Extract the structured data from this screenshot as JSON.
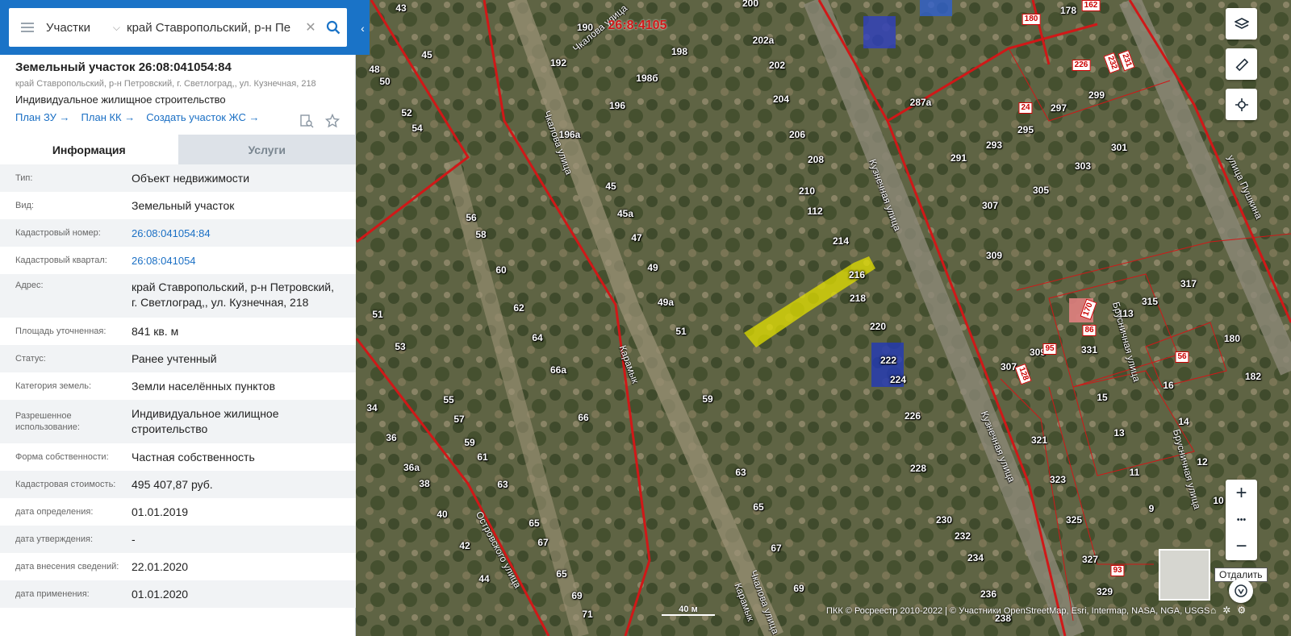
{
  "search": {
    "type_label": "Участки",
    "value": "край Ставропольский, р-н Пе",
    "clear": "✕"
  },
  "object": {
    "title": "Земельный участок 26:08:041054:84",
    "address": "край Ставропольский, р-н Петровский, г. Светлоград,, ул. Кузнечная, 218",
    "use": "Индивидуальное жилищное строительство",
    "links": [
      "План ЗУ →",
      "План КК →",
      "Создать участок ЖС →"
    ]
  },
  "tabs": [
    "Информация",
    "Услуги"
  ],
  "rows": [
    {
      "key": "Тип:",
      "value": "Объект недвижимости"
    },
    {
      "key": "Вид:",
      "value": "Земельный участок"
    },
    {
      "key": "Кадастровый номер:",
      "value": "26:08:041054:84",
      "link": true
    },
    {
      "key": "Кадастровый квартал:",
      "value": "26:08:041054",
      "link": true
    },
    {
      "key": "Адрес:",
      "value": "край Ставропольский, р-н Петровский, г. Светлоград,, ул. Кузнечная, 218"
    },
    {
      "key": "Площадь уточненная:",
      "value": "841 кв. м"
    },
    {
      "key": "Статус:",
      "value": "Ранее учтенный"
    },
    {
      "key": "Категория земель:",
      "value": "Земли населённых пунктов"
    },
    {
      "key": "Разрешенное использование:",
      "value": "Индивидуальное жилищное строительство"
    },
    {
      "key": "Форма собственности:",
      "value": "Частная собственность"
    },
    {
      "key": "Кадастровая стоимость:",
      "value": "495 407,87 руб."
    },
    {
      "key": "дата определения:",
      "value": "01.01.2019"
    },
    {
      "key": "дата утверждения:",
      "value": "-"
    },
    {
      "key": "дата внесения сведений:",
      "value": "22.01.2020"
    },
    {
      "key": "дата применения:",
      "value": "01.01.2020"
    }
  ],
  "map": {
    "house_numbers": [
      "43",
      "190",
      "198",
      "200",
      "202а",
      "202",
      "198б",
      "192",
      "196",
      "196а",
      "204",
      "206",
      "208",
      "210",
      "112",
      "214",
      "216",
      "218",
      "220",
      "222",
      "224",
      "226",
      "228",
      "230",
      "232",
      "234",
      "236",
      "238",
      "45",
      "45а",
      "47",
      "49",
      "49а",
      "51",
      "59",
      "63",
      "65",
      "67",
      "69",
      "45",
      "48",
      "50",
      "52",
      "54",
      "56",
      "58",
      "60",
      "62",
      "64",
      "66а",
      "66",
      "51",
      "53",
      "55",
      "57",
      "59",
      "61",
      "63",
      "65",
      "67",
      "65",
      "69",
      "71",
      "34",
      "36",
      "36а",
      "38",
      "40",
      "42",
      "44",
      "287а",
      "297",
      "299",
      "291",
      "293",
      "295",
      "301",
      "303",
      "305",
      "307",
      "309",
      "317",
      "315",
      "113",
      "331",
      "309",
      "307",
      "321",
      "323",
      "325",
      "327",
      "329",
      "13",
      "15",
      "16",
      "14",
      "11",
      "12",
      "9",
      "10",
      "180",
      "182",
      "178"
    ],
    "streets": [
      "Чкалова улица",
      "Чкалова улица",
      "Чкалова улица",
      "Кузнечная улица",
      "Кузнечная улица",
      "Островского улица",
      "Брусничная улица",
      "Брусничная улица",
      "улица Пушкина",
      "Карамык",
      "Карамык"
    ],
    "parcel_labels": [
      "26:8:4105",
      "180",
      "162",
      "226",
      "232",
      "231",
      "24",
      "170",
      "86",
      "95",
      "128",
      "56",
      "93"
    ],
    "scale_label": "40 м",
    "copyright": "ПКК © Росреестр 2010-2022 | © Участники OpenStreetMap, Esri, Intermap, NASA, NGA, USGS",
    "tooltip": "Отдалить",
    "zoom_in": "+",
    "zoom_more": "•••",
    "zoom_out": "−"
  }
}
